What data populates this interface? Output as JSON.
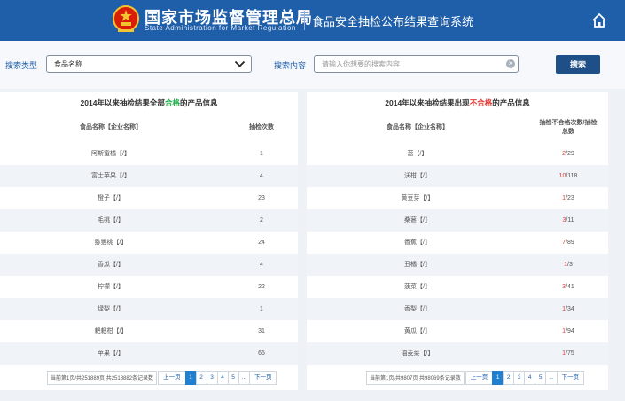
{
  "header": {
    "brand_cn": "国家市场监督管理总局",
    "brand_en": "State Administration  for  Market Regulation",
    "system_title": "食品安全抽检公布结果查询系统",
    "bg_color": "#1f5faa"
  },
  "search": {
    "type_label": "搜索类型",
    "type_value": "食品名称",
    "content_label": "搜索内容",
    "placeholder": "请输入你想要的搜索内容",
    "button_label": "搜索"
  },
  "qualified": {
    "title_pre": "2014年以来抽检结果全部",
    "title_hl": "合格",
    "title_post": "的产品信息",
    "col_name": "食品名称【企业名称】",
    "col_count": "抽检次数",
    "rows": [
      {
        "name": "阿斯蜜橘【/】",
        "count": "1"
      },
      {
        "name": "富士苹果【/】",
        "count": "4"
      },
      {
        "name": "橙子【/】",
        "count": "23"
      },
      {
        "name": "毛桃【/】",
        "count": "2"
      },
      {
        "name": "猕猴桃【/】",
        "count": "24"
      },
      {
        "name": "香瓜【/】",
        "count": "4"
      },
      {
        "name": "柠檬【/】",
        "count": "22"
      },
      {
        "name": "绿梨【/】",
        "count": "1"
      },
      {
        "name": "耙耙柑【/】",
        "count": "31"
      },
      {
        "name": "苹果【/】",
        "count": "65"
      }
    ],
    "pager": {
      "info": "当前第1页/共251889页 共2518882条记录数",
      "prev": "上一页",
      "pages": [
        "1",
        "2",
        "3",
        "4",
        "5",
        "..."
      ],
      "next": "下一页"
    }
  },
  "unqualified": {
    "title_pre": "2014年以来抽检结果出现",
    "title_hl": "不合格",
    "title_post": "的产品信息",
    "col_name": "食品名称【企业名称】",
    "col_ratio_line1": "抽检不合格次数/抽检",
    "col_ratio_line2": "总数",
    "rows": [
      {
        "name": "葱【/】",
        "fail": "2",
        "total": "/29"
      },
      {
        "name": "沃柑【/】",
        "fail": "10",
        "total": "/118"
      },
      {
        "name": "黄豆芽【/】",
        "fail": "1",
        "total": "/23"
      },
      {
        "name": "桑葚【/】",
        "fail": "3",
        "total": "/11"
      },
      {
        "name": "香蕉【/】",
        "fail": "7",
        "total": "/89"
      },
      {
        "name": "丑橘【/】",
        "fail": "1",
        "total": "/3"
      },
      {
        "name": "菠菜【/】",
        "fail": "3",
        "total": "/41"
      },
      {
        "name": "香梨【/】",
        "fail": "1",
        "total": "/34"
      },
      {
        "name": "黄瓜【/】",
        "fail": "1",
        "total": "/94"
      },
      {
        "name": "油麦菜【/】",
        "fail": "1",
        "total": "/75"
      }
    ],
    "pager": {
      "info": "当前第1页/共9807页 共98069条记录数",
      "prev": "上一页",
      "pages": [
        "1",
        "2",
        "3",
        "4",
        "5",
        "..."
      ],
      "next": "下一页"
    }
  },
  "icons": {
    "emblem": "national-emblem-icon",
    "home": "home-icon",
    "chevron": "chevron-down-icon",
    "clear": "clear-icon"
  },
  "colors": {
    "accent_green": "#20b14b",
    "accent_red": "#e53935",
    "button_navy": "#1e4f86",
    "page_active": "#1f7fd0"
  }
}
